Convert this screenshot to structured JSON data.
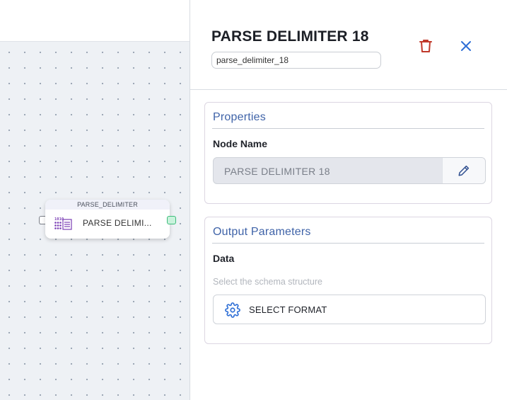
{
  "canvas": {
    "node": {
      "type_label": "PARSE_DELIMITER",
      "label": "PARSE DELIMI...",
      "icon": "parse-delimiter-icon"
    }
  },
  "panel": {
    "title": "PARSE DELIMITER 18",
    "node_id": "parse_delimiter_18",
    "delete_icon": "trash-icon",
    "close_icon": "close-icon",
    "properties": {
      "heading": "Properties",
      "node_name_label": "Node Name",
      "node_name_value": "PARSE DELIMITER 18",
      "edit_icon": "pencil-icon"
    },
    "output": {
      "heading": "Output Parameters",
      "data_label": "Data",
      "hint": "Select the schema structure",
      "format_button": "SELECT FORMAT",
      "format_icon": "gear-icon"
    }
  },
  "colors": {
    "accent": "#3f63a8",
    "delete": "#c0392b",
    "close": "#2f6fd6",
    "port_out": "#3dbc7b"
  }
}
